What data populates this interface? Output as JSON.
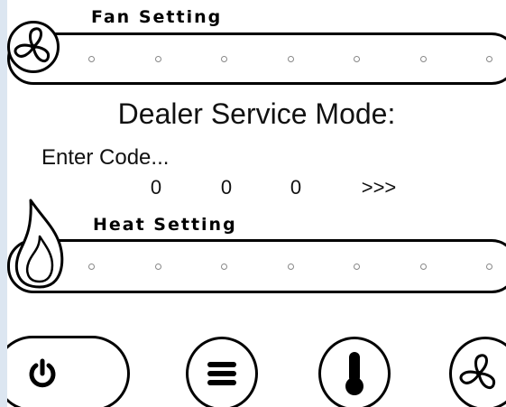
{
  "fan": {
    "label": "Fan Setting",
    "level_count": 7
  },
  "heat": {
    "label": "Heat Setting",
    "level_count": 7
  },
  "title": "Dealer Service Mode:",
  "code": {
    "prompt": "Enter Code...",
    "digits": [
      "0",
      "0",
      "0"
    ],
    "next": ">>>"
  },
  "icons": {
    "fan_slider": "fan-icon",
    "heat_slider": "flame-icon",
    "power": "power-icon",
    "menu": "menu-icon",
    "temperature": "thermometer-icon",
    "fan_mode": "fan-icon"
  },
  "colors": {
    "background": "#ffffff",
    "outline": "#000000",
    "dot": "#888888"
  }
}
